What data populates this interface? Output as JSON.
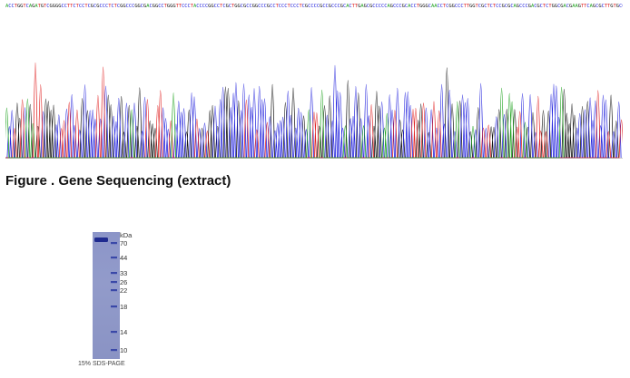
{
  "sequence": {
    "bases": "ACCTGGTCAGATGTCGGGGCCTTCTCCTCGCGCCCTCTCGGCCCGGCGACGGCCTGGGTTCCCTACCCCGGCCTCGCTGGCGCCGGCCCGCCTCCCTCCCTCGCCCCGCCGCCCGCACTTGAGCGCCCCCAGCCCGCACCTGGGCAACCTCGGCCCTTGGTCGCTCTCCGCGCAGCCCGACGCTCTGGCGACGAAGTTCAGCGCTTGTGCCCCAGGGGGCCGCGCCCTCCCTGCGCT"
  },
  "chromatogram": {
    "colors": {
      "A": "#1aa01a",
      "C": "#2222dd",
      "G": "#111111",
      "T": "#e02020"
    }
  },
  "figure": {
    "caption": "Figure . Gene Sequencing (extract)"
  },
  "gel": {
    "unit": "kDa",
    "markers": [
      "70",
      "44",
      "33",
      "26",
      "22",
      "18",
      "14",
      "10"
    ],
    "caption": "15% SDS-PAGE"
  }
}
